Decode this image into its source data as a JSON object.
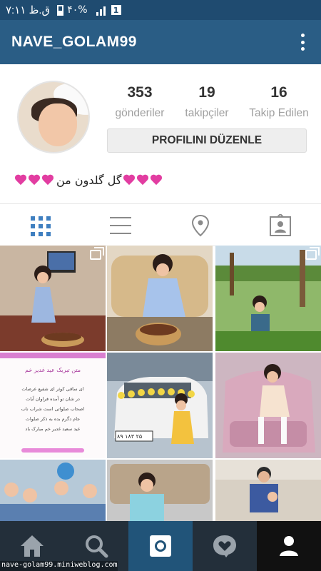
{
  "status_bar": {
    "time": "۷:۱۱ ق.ظ",
    "battery": "۴۰%",
    "notification_badge": "1"
  },
  "app_bar": {
    "username": "NAVE_GOLAM99"
  },
  "profile": {
    "stats": [
      {
        "value": "353",
        "label": "gönderiler"
      },
      {
        "value": "19",
        "label": "takipçiler"
      },
      {
        "value": "16",
        "label": "Takip Edilen"
      }
    ],
    "edit_button_label": "PROFILINI DÜZENLE",
    "bio_text": "گل گلدون من"
  },
  "tabs": [
    "grid-icon",
    "list-icon",
    "location-pin-icon",
    "tagged-person-icon"
  ],
  "photo_card": {
    "title": "متن تبریک عید غدیر خم",
    "lines": [
      "ای ساقی کوثر ای شفیع عرصات",
      "در شان تو آمده فراوان آیات",
      "اصحاب صلواتی است شراب ناب",
      "جام دگرم بده به ذکر صلوات",
      "عید سعید غدیر خم مبارک باد"
    ]
  },
  "car_plate": "۸۹ ۱۸۳ ۲۵",
  "bottom_nav": [
    "home-icon",
    "search-icon",
    "camera-icon",
    "activity-icon",
    "profile-icon"
  ],
  "watermark": "nave-golam99.miniweblog.com",
  "colors": {
    "status_bar": "#1f4b70",
    "app_bar": "#2a5d85",
    "accent": "#3f7fc0",
    "nav_bg": "#232f3a",
    "heart": "#e23da1"
  }
}
